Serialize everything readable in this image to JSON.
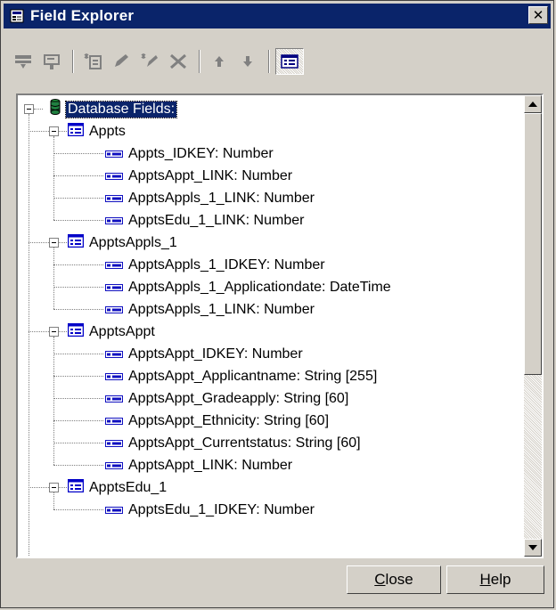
{
  "window": {
    "title": "Field Explorer",
    "close_glyph": "✕"
  },
  "toolbar": {
    "buttons": [
      {
        "name": "insert-field-icon",
        "enabled": false
      },
      {
        "name": "browse-field-icon",
        "enabled": false
      },
      {
        "name": "new-formula-icon",
        "enabled": false
      },
      {
        "name": "edit-icon",
        "enabled": false
      },
      {
        "name": "rename-icon",
        "enabled": false
      },
      {
        "name": "delete-icon",
        "enabled": false
      },
      {
        "name": "move-up-icon",
        "enabled": false
      },
      {
        "name": "move-down-icon",
        "enabled": false
      },
      {
        "name": "show-field-type-icon",
        "enabled": true,
        "pressed": true
      }
    ]
  },
  "tree": {
    "root": "Database Fields:",
    "tables": [
      {
        "name": "Appts",
        "fields": [
          "Appts_IDKEY: Number",
          "ApptsAppt_LINK: Number",
          "ApptsAppls_1_LINK: Number",
          "ApptsEdu_1_LINK: Number"
        ]
      },
      {
        "name": "ApptsAppls_1",
        "fields": [
          "ApptsAppls_1_IDKEY: Number",
          "ApptsAppls_1_Applicationdate: DateTime",
          "ApptsAppls_1_LINK: Number"
        ]
      },
      {
        "name": "ApptsAppt",
        "fields": [
          "ApptsAppt_IDKEY: Number",
          "ApptsAppt_Applicantname: String [255]",
          "ApptsAppt_Gradeapply: String [60]",
          "ApptsAppt_Ethnicity: String [60]",
          "ApptsAppt_Currentstatus: String [60]",
          "ApptsAppt_LINK: Number"
        ]
      },
      {
        "name": "ApptsEdu_1",
        "fields": [
          "ApptsEdu_1_IDKEY: Number"
        ]
      }
    ]
  },
  "footer": {
    "close_label_accel": "C",
    "close_label_rest": "lose",
    "help_label_accel": "H",
    "help_label_rest": "elp"
  },
  "colors": {
    "titlebar": "#0a246a",
    "face": "#d4d0c8",
    "selection": "#0a246a",
    "field_icon": "#1010c0",
    "table_icon": "#0000c8"
  }
}
